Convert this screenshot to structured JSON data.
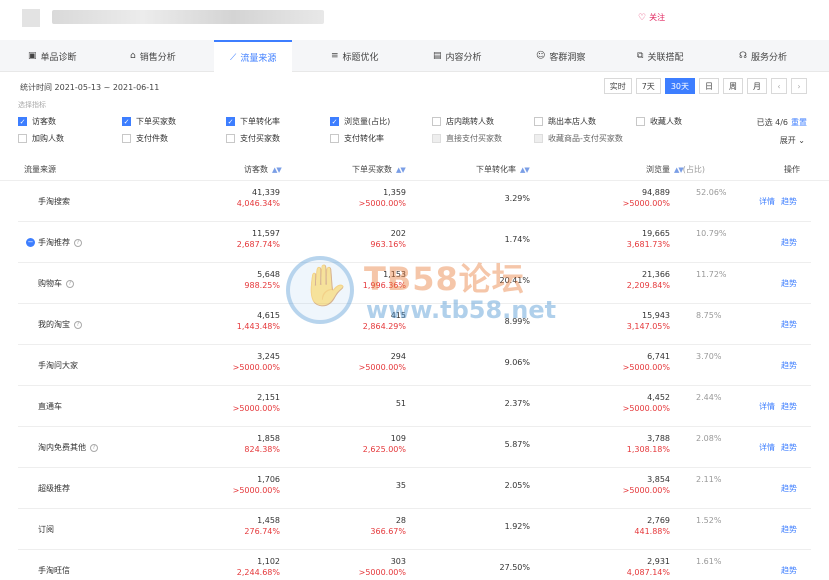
{
  "header": {
    "follow_label": "关注"
  },
  "tabs": [
    {
      "label": "单品诊断",
      "icon": "box-icon"
    },
    {
      "label": "销售分析",
      "icon": "bag-icon"
    },
    {
      "label": "流量来源",
      "icon": "trend-icon",
      "active": true
    },
    {
      "label": "标题优化",
      "icon": "title-icon"
    },
    {
      "label": "内容分析",
      "icon": "doc-icon"
    },
    {
      "label": "客群洞察",
      "icon": "user-icon"
    },
    {
      "label": "关联搭配",
      "icon": "link-icon"
    },
    {
      "label": "服务分析",
      "icon": "headset-icon"
    }
  ],
  "period": {
    "text": "统计时间 2021-05-13 ~ 2021-06-11"
  },
  "range_buttons": [
    {
      "label": "实时"
    },
    {
      "label": "7天"
    },
    {
      "label": "30天",
      "active": true
    },
    {
      "label": "日"
    },
    {
      "label": "周"
    },
    {
      "label": "月"
    }
  ],
  "metrics": {
    "label": "选择指标",
    "items": [
      {
        "label": "访客数",
        "state": "on"
      },
      {
        "label": "下单买家数",
        "state": "on"
      },
      {
        "label": "下单转化率",
        "state": "on"
      },
      {
        "label": "浏览量(占比)",
        "state": "on"
      },
      {
        "label": "店内跳转人数",
        "state": "off"
      },
      {
        "label": "跳出本店人数",
        "state": "off"
      },
      {
        "label": "收藏人数",
        "state": "off"
      },
      {
        "label": "加购人数",
        "state": "off"
      },
      {
        "label": "支付件数",
        "state": "off"
      },
      {
        "label": "支付买家数",
        "state": "off"
      },
      {
        "label": "支付转化率",
        "state": "off"
      },
      {
        "label": "直接支付买家数",
        "state": "disabled"
      },
      {
        "label": "收藏商品-支付买家数",
        "state": "disabled"
      }
    ],
    "selected_text": "已选 4/6",
    "reset_label": "重置",
    "expand_label": "展开"
  },
  "table": {
    "headers": {
      "source": "流量来源",
      "visitors": "访客数",
      "buyers": "下单买家数",
      "conversion": "下单转化率",
      "pageviews": "浏览量",
      "share": "(占比)",
      "ops": "操作"
    },
    "detail_label": "详情",
    "trend_label": "趋势",
    "rows": [
      {
        "name": "手淘搜索",
        "visitors": "41,339",
        "visitors_pct": "4,046.34%",
        "buyers": "1,359",
        "buyers_pct": ">5000.00%",
        "conversion": "3.29%",
        "pageviews": "94,889",
        "pageviews_pct": ">5000.00%",
        "share": "52.06%",
        "help": false,
        "expand": false,
        "detail": true
      },
      {
        "name": "手淘推荐",
        "visitors": "11,597",
        "visitors_pct": "2,687.74%",
        "buyers": "202",
        "buyers_pct": "963.16%",
        "conversion": "1.74%",
        "pageviews": "19,665",
        "pageviews_pct": "3,681.73%",
        "share": "10.79%",
        "help": true,
        "expand": true,
        "detail": false
      },
      {
        "name": "购物车",
        "visitors": "5,648",
        "visitors_pct": "988.25%",
        "buyers": "1,153",
        "buyers_pct": "1,996.36%",
        "conversion": "20.41%",
        "pageviews": "21,366",
        "pageviews_pct": "2,209.84%",
        "share": "11.72%",
        "help": true,
        "expand": false,
        "detail": false
      },
      {
        "name": "我的淘宝",
        "visitors": "4,615",
        "visitors_pct": "1,443.48%",
        "buyers": "415",
        "buyers_pct": "2,864.29%",
        "conversion": "8.99%",
        "pageviews": "15,943",
        "pageviews_pct": "3,147.05%",
        "share": "8.75%",
        "help": true,
        "expand": false,
        "detail": false
      },
      {
        "name": "手淘问大家",
        "visitors": "3,245",
        "visitors_pct": ">5000.00%",
        "buyers": "294",
        "buyers_pct": ">5000.00%",
        "conversion": "9.06%",
        "pageviews": "6,741",
        "pageviews_pct": ">5000.00%",
        "share": "3.70%",
        "help": false,
        "expand": false,
        "detail": false
      },
      {
        "name": "直通车",
        "visitors": "2,151",
        "visitors_pct": ">5000.00%",
        "buyers": "51",
        "buyers_pct": "",
        "conversion": "2.37%",
        "pageviews": "4,452",
        "pageviews_pct": ">5000.00%",
        "share": "2.44%",
        "help": false,
        "expand": false,
        "detail": true
      },
      {
        "name": "淘内免费其他",
        "visitors": "1,858",
        "visitors_pct": "824.38%",
        "buyers": "109",
        "buyers_pct": "2,625.00%",
        "conversion": "5.87%",
        "pageviews": "3,788",
        "pageviews_pct": "1,308.18%",
        "share": "2.08%",
        "help": true,
        "expand": false,
        "detail": true
      },
      {
        "name": "超级推荐",
        "visitors": "1,706",
        "visitors_pct": ">5000.00%",
        "buyers": "35",
        "buyers_pct": "",
        "conversion": "2.05%",
        "pageviews": "3,854",
        "pageviews_pct": ">5000.00%",
        "share": "2.11%",
        "help": false,
        "expand": false,
        "detail": false
      },
      {
        "name": "订阅",
        "visitors": "1,458",
        "visitors_pct": "276.74%",
        "buyers": "28",
        "buyers_pct": "366.67%",
        "conversion": "1.92%",
        "pageviews": "2,769",
        "pageviews_pct": "441.88%",
        "share": "1.52%",
        "help": false,
        "expand": false,
        "detail": false
      },
      {
        "name": "手淘旺信",
        "visitors": "1,102",
        "visitors_pct": "2,244.68%",
        "buyers": "303",
        "buyers_pct": ">5000.00%",
        "conversion": "27.50%",
        "pageviews": "2,931",
        "pageviews_pct": "4,087.14%",
        "share": "1.61%",
        "help": false,
        "expand": false,
        "detail": false
      }
    ]
  },
  "watermark": {
    "title": "TB58论坛",
    "url": "www.tb58.net"
  }
}
